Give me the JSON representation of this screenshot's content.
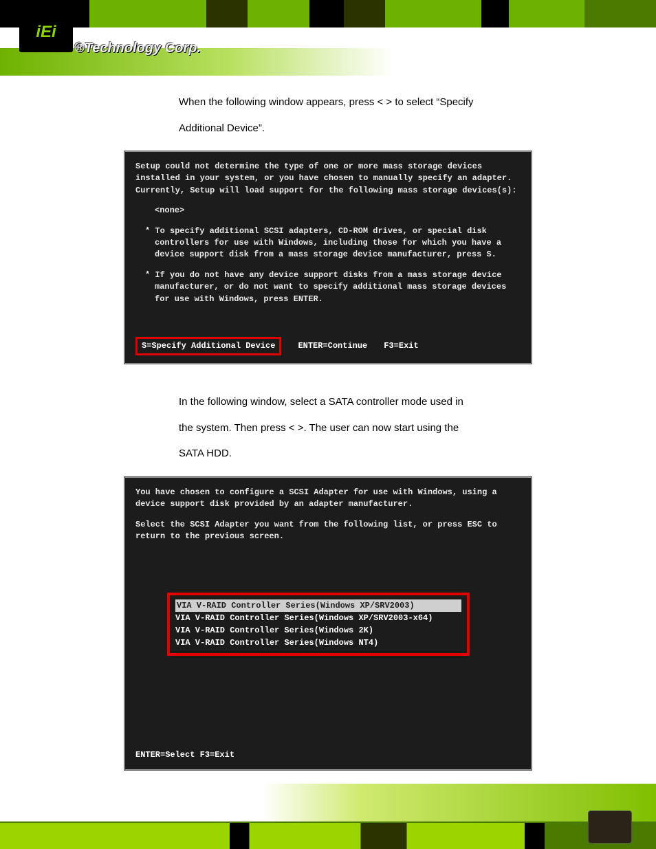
{
  "brand": {
    "logo": "iEi",
    "slogan": "®Technology Corp."
  },
  "para1": "When the following window appears, press <  > to select “Specify Additional Device”.",
  "para2": "In the following window, select a SATA controller mode used in the system. Then press <        >. The user can now start using the SATA HDD.",
  "screen1": {
    "line1": "Setup could not determine the type of one or more mass storage devices installed in your system, or you have chosen to manually specify an adapter. Currently, Setup will load support for the following mass storage devices(s):",
    "none": "<none>",
    "b1": "* To specify additional SCSI adapters, CD-ROM drives, or special disk controllers for use with Windows, including those for which you have a device support disk from a mass storage device manufacturer, press S.",
    "b2": "* If you do not have any device support disks from a mass storage device manufacturer, or do not want to specify additional mass storage devices for use with Windows, press ENTER.",
    "status": {
      "s": "S=Specify Additional Device",
      "enter": "ENTER=Continue",
      "f3": "F3=Exit"
    }
  },
  "screen2": {
    "line1": "You have chosen to configure a SCSI Adapter for use with Windows, using a device support disk provided by an adapter manufacturer.",
    "line2": "Select the SCSI Adapter you want from the following list, or press ESC to return to the previous screen.",
    "options": [
      "VIA V-RAID Controller Series(Windows XP/SRV2003)",
      "VIA V-RAID Controller Series(Windows XP/SRV2003-x64)",
      "VIA V-RAID Controller Series(Windows 2K)",
      "VIA V-RAID Controller Series(Windows NT4)"
    ],
    "status": "ENTER=Select  F3=Exit"
  }
}
